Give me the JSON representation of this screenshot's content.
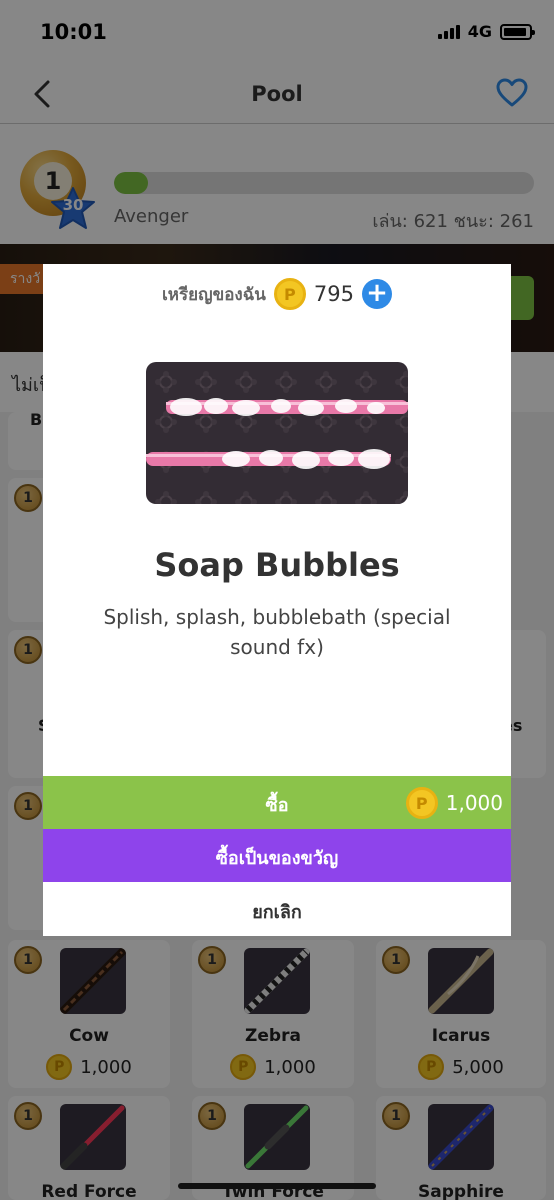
{
  "status_bar": {
    "time": "10:01",
    "network": "4G"
  },
  "header": {
    "title": "Pool"
  },
  "profile": {
    "level": "1",
    "level_badge": "30",
    "rank": "Avenger",
    "stats": "เล่น: 621 ชนะ: 261",
    "xp_progress": 0.08
  },
  "banner": {
    "tag": "รางวั"
  },
  "filter": {
    "label": "ไม่เป็"
  },
  "background_cards": [
    {
      "name": "Cow",
      "price": "1,000",
      "coin_label": "1",
      "currency_icon": "P"
    },
    {
      "name": "Zebra",
      "price": "1,000",
      "coin_label": "1",
      "currency_icon": "P"
    },
    {
      "name": "Icarus",
      "price": "5,000",
      "coin_label": "1",
      "currency_icon": "P"
    },
    {
      "name": "Red Force",
      "coin_label": "1"
    },
    {
      "name": "Twin Force",
      "coin_label": "1"
    },
    {
      "name": "Sapphire",
      "coin_label": "1"
    }
  ],
  "partial_texts": {
    "bu": "Bu",
    "s": "S",
    "es": "es"
  },
  "modal": {
    "wallet_label": "เหรียญของฉัน",
    "wallet_amount": "795",
    "currency_icon": "P",
    "add_symbol": "+",
    "item_name": "Soap Bubbles",
    "item_description": "Splish, splash, bubblebath (special sound fx)",
    "buy_label": "ซื้อ",
    "buy_price": "1,000",
    "gift_label": "ซื้อเป็นของขวัญ",
    "cancel_label": "ยกเลิก"
  },
  "colors": {
    "accent_green": "#8bc34a",
    "accent_purple": "#8e44eb",
    "link_blue": "#2e8ae6",
    "coin_gold": "#f3c623"
  },
  "icons": [
    "back-chevron-icon",
    "heart-icon",
    "signal-icon",
    "battery-icon",
    "plus-icon",
    "coin-icon",
    "level-star-icon"
  ]
}
